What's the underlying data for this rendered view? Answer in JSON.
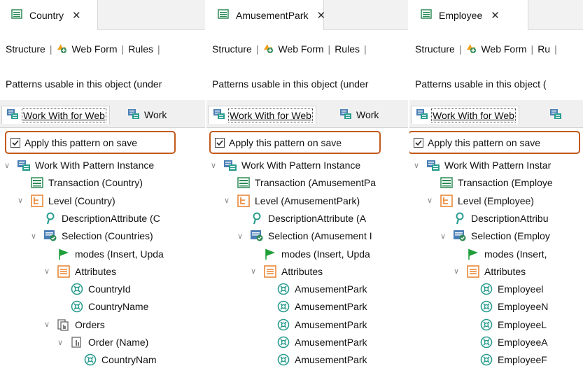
{
  "panels": [
    {
      "tab_label": "Country",
      "toolbar": {
        "structure": "Structure",
        "web_form": "Web Form",
        "rules": "Rules"
      },
      "description": "Patterns usable in this object (under",
      "pattern_tabs": {
        "active": "Work With for Web",
        "second": "Work"
      },
      "apply_label": "Apply this pattern on save",
      "tree": [
        {
          "level": 0,
          "icon": "work-with-icon",
          "label": "Work With Pattern Instance",
          "expanded": true
        },
        {
          "level": 1,
          "icon": "transaction-icon",
          "label": "Transaction (Country)",
          "expanded": null
        },
        {
          "level": 1,
          "icon": "level-icon",
          "label": "Level (Country)",
          "expanded": true
        },
        {
          "level": 2,
          "icon": "description-attribute-icon",
          "label": "DescriptionAttribute (C",
          "expanded": null
        },
        {
          "level": 2,
          "icon": "selection-icon",
          "label": "Selection (Countries)",
          "expanded": true
        },
        {
          "level": 3,
          "icon": "modes-flag-icon",
          "label": "modes (Insert, Upda",
          "expanded": null
        },
        {
          "level": 3,
          "icon": "attributes-icon",
          "label": "Attributes",
          "expanded": true
        },
        {
          "level": 4,
          "icon": "attribute-icon",
          "label": "CountryId",
          "expanded": null
        },
        {
          "level": 4,
          "icon": "attribute-icon",
          "label": "CountryName",
          "expanded": null
        },
        {
          "level": 3,
          "icon": "orders-icon",
          "label": "Orders",
          "expanded": true
        },
        {
          "level": 4,
          "icon": "order-icon",
          "label": "Order (Name)",
          "expanded": true
        },
        {
          "level": 5,
          "icon": "attribute-icon",
          "label": "CountryNam",
          "expanded": null
        }
      ]
    },
    {
      "tab_label": "AmusementPark",
      "toolbar": {
        "structure": "Structure",
        "web_form": "Web Form",
        "rules": "Rules"
      },
      "description": "Patterns usable in this object (under",
      "pattern_tabs": {
        "active": "Work With for Web",
        "second": "Work"
      },
      "apply_label": "Apply this pattern on save",
      "tree": [
        {
          "level": 0,
          "icon": "work-with-icon",
          "label": "Work With Pattern Instance",
          "expanded": true
        },
        {
          "level": 1,
          "icon": "transaction-icon",
          "label": "Transaction (AmusementPa",
          "expanded": null
        },
        {
          "level": 1,
          "icon": "level-icon",
          "label": "Level (AmusementPark)",
          "expanded": true
        },
        {
          "level": 2,
          "icon": "description-attribute-icon",
          "label": "DescriptionAttribute (A",
          "expanded": null
        },
        {
          "level": 2,
          "icon": "selection-icon",
          "label": "Selection (Amusement I",
          "expanded": true
        },
        {
          "level": 3,
          "icon": "modes-flag-icon",
          "label": "modes (Insert, Upda",
          "expanded": null
        },
        {
          "level": 3,
          "icon": "attributes-icon",
          "label": "Attributes",
          "expanded": true
        },
        {
          "level": 4,
          "icon": "attribute-icon",
          "label": "AmusementPark",
          "expanded": null
        },
        {
          "level": 4,
          "icon": "attribute-icon",
          "label": "AmusementPark",
          "expanded": null
        },
        {
          "level": 4,
          "icon": "attribute-icon",
          "label": "AmusementPark",
          "expanded": null
        },
        {
          "level": 4,
          "icon": "attribute-icon",
          "label": "AmusementPark",
          "expanded": null
        },
        {
          "level": 4,
          "icon": "attribute-icon",
          "label": "AmusementPark",
          "expanded": null
        }
      ]
    },
    {
      "tab_label": "Employee",
      "toolbar": {
        "structure": "Structure",
        "web_form": "Web Form",
        "rules": "Ru"
      },
      "description": "Patterns usable in this object (",
      "pattern_tabs": {
        "active": "Work With for Web",
        "second": ""
      },
      "apply_label": "Apply this pattern on save",
      "tree": [
        {
          "level": 0,
          "icon": "work-with-icon",
          "label": "Work With Pattern Instar",
          "expanded": true
        },
        {
          "level": 1,
          "icon": "transaction-icon",
          "label": "Transaction (Employe",
          "expanded": null
        },
        {
          "level": 1,
          "icon": "level-icon",
          "label": "Level (Employee)",
          "expanded": true
        },
        {
          "level": 2,
          "icon": "description-attribute-icon",
          "label": "DescriptionAttribu",
          "expanded": null
        },
        {
          "level": 2,
          "icon": "selection-icon",
          "label": "Selection (Employ",
          "expanded": true
        },
        {
          "level": 3,
          "icon": "modes-flag-icon",
          "label": "modes (Insert,",
          "expanded": null
        },
        {
          "level": 3,
          "icon": "attributes-icon",
          "label": "Attributes",
          "expanded": true
        },
        {
          "level": 4,
          "icon": "attribute-icon",
          "label": "Employeel",
          "expanded": null
        },
        {
          "level": 4,
          "icon": "attribute-icon",
          "label": "EmployeeN",
          "expanded": null
        },
        {
          "level": 4,
          "icon": "attribute-icon",
          "label": "EmployeeL",
          "expanded": null
        },
        {
          "level": 4,
          "icon": "attribute-icon",
          "label": "EmployeeA",
          "expanded": null
        },
        {
          "level": 4,
          "icon": "attribute-icon",
          "label": "EmployeeF",
          "expanded": null
        }
      ]
    }
  ],
  "colors": {
    "highlight_border": "#c25a1c",
    "link_green": "#2e8b57",
    "icon_teal": "#2a9d8f",
    "icon_orange": "#e8812c"
  }
}
